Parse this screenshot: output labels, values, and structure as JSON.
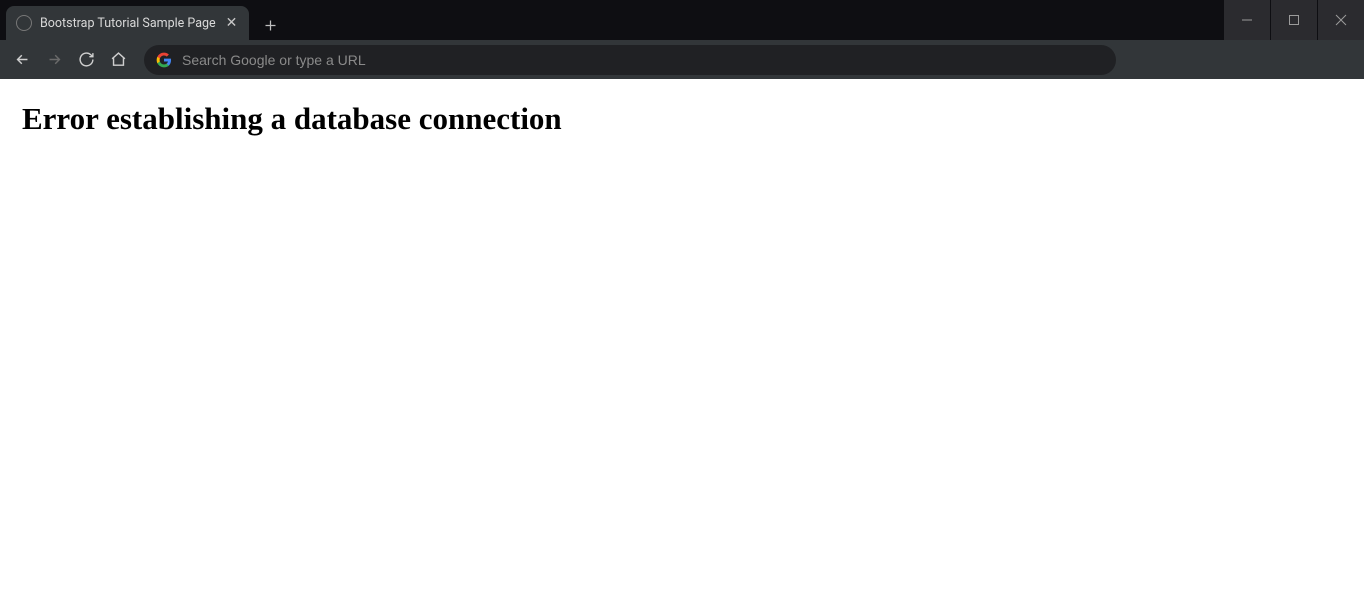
{
  "browser": {
    "tab": {
      "title": "Bootstrap Tutorial Sample Page"
    },
    "omnibox": {
      "placeholder": "Search Google or type a URL",
      "value": ""
    }
  },
  "page": {
    "error_heading": "Error establishing a database connection"
  }
}
